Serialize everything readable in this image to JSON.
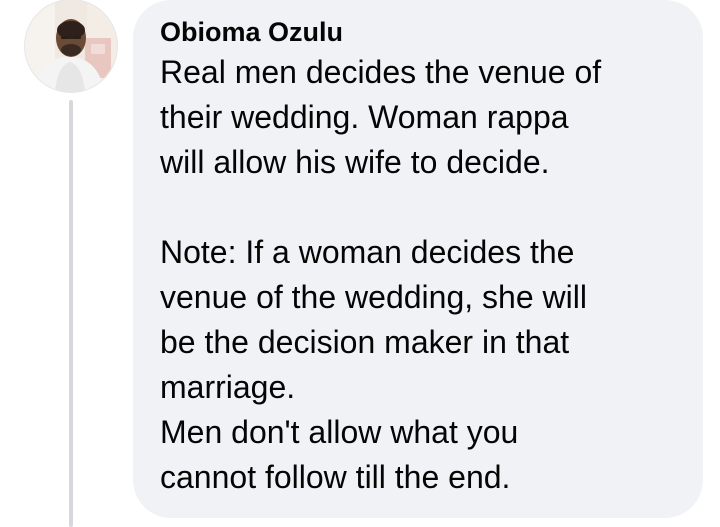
{
  "comment": {
    "author": "Obioma Ozulu",
    "paragraph_1": [
      "Real men decides the venue of",
      "their wedding. Woman rappa",
      "will allow his wife to decide."
    ],
    "paragraph_2": [
      "Note: If a woman decides the",
      "venue of the wedding, she will",
      "be the decision maker in that",
      "marriage."
    ],
    "paragraph_3": [
      "Men don't allow what you",
      "cannot follow till the end."
    ]
  },
  "colors": {
    "bubble_background": "#f0f2f5",
    "text": "#050505",
    "thread_line": "#d6d8dc"
  },
  "icons": {
    "avatar": "profile-photo"
  }
}
